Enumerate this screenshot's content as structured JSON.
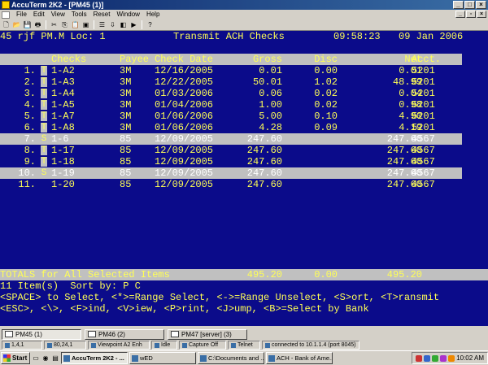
{
  "window": {
    "title": "AccuTerm 2K2 - [PM45 (1)]"
  },
  "menu": {
    "items": [
      "File",
      "Edit",
      "View",
      "Tools",
      "Reset",
      "Window",
      "Help"
    ]
  },
  "toolbar": {
    "icons": [
      "new-icon",
      "open-icon",
      "save-icon",
      "print-icon",
      "cut-icon",
      "copy-icon",
      "paste-icon",
      "select-icon",
      "properties-icon",
      "download-icon",
      "capture-icon",
      "run-icon",
      "help-icon"
    ]
  },
  "terminal": {
    "header_left": "45 rjf PM.M Loc: 1",
    "header_title": "Transmit ACH Checks",
    "header_time": "09:58:23",
    "header_date": "09 Jan 2006",
    "columns": {
      "checks": "Checks",
      "payee": "Payee",
      "date": "Check Date",
      "gross": "Gross",
      "disc": "Disc",
      "net": "Net",
      "acct": "Acct."
    },
    "rows": [
      {
        "idx": "1.",
        "flag": "T",
        "check": "1-A2",
        "payee": "3M",
        "date": "12/16/2005",
        "gross": "0.01",
        "disc": "0.00",
        "net": "0.01",
        "acct": "5201"
      },
      {
        "idx": "2.",
        "flag": "T",
        "check": "1-A3",
        "payee": "3M",
        "date": "12/22/2005",
        "gross": "50.01",
        "disc": "1.02",
        "net": "48.99",
        "acct": "5201"
      },
      {
        "idx": "3.",
        "flag": "T",
        "check": "1-A4",
        "payee": "3M",
        "date": "01/03/2006",
        "gross": "0.06",
        "disc": "0.02",
        "net": "0.04",
        "acct": "5201"
      },
      {
        "idx": "4.",
        "flag": "T",
        "check": "1-A5",
        "payee": "3M",
        "date": "01/04/2006",
        "gross": "1.00",
        "disc": "0.02",
        "net": "0.98",
        "acct": "5201"
      },
      {
        "idx": "5.",
        "flag": "T",
        "check": "1-A7",
        "payee": "3M",
        "date": "01/06/2006",
        "gross": "5.00",
        "disc": "0.10",
        "net": "4.90",
        "acct": "5201"
      },
      {
        "idx": "6.",
        "flag": "T",
        "check": "1-A8",
        "payee": "3M",
        "date": "01/06/2006",
        "gross": "4.28",
        "disc": "0.09",
        "net": "4.19",
        "acct": "5201"
      },
      {
        "idx": "7.",
        "flag": "S",
        "check": "1-6",
        "payee": "85",
        "date": "12/09/2005",
        "gross": "247.60",
        "disc": "",
        "net": "247.60",
        "acct": "4567",
        "selected": true
      },
      {
        "idx": "8.",
        "flag": "T",
        "check": "1-17",
        "payee": "85",
        "date": "12/09/2005",
        "gross": "247.60",
        "disc": "",
        "net": "247.60",
        "acct": "4567"
      },
      {
        "idx": "9.",
        "flag": "T",
        "check": "1-18",
        "payee": "85",
        "date": "12/09/2005",
        "gross": "247.60",
        "disc": "",
        "net": "247.60",
        "acct": "4567"
      },
      {
        "idx": "10.",
        "flag": "S",
        "check": "1-19",
        "payee": "85",
        "date": "12/09/2005",
        "gross": "247.60",
        "disc": "",
        "net": "247.60",
        "acct": "4567",
        "selected": true
      },
      {
        "idx": "11.",
        "flag": "",
        "check": "1-20",
        "payee": "85",
        "date": "12/09/2005",
        "gross": "247.60",
        "disc": "",
        "net": "247.60",
        "acct": "4567"
      }
    ],
    "totals_label": "TOTALS for All Selected Items",
    "totals_gross": "495.20",
    "totals_disc": "0.00",
    "totals_net": "495.20",
    "items_line": "11 Item(s)  Sort by: P C",
    "help_line_1": "<SPACE> to Select, <*>=Range Select, <->=Range Unselect, <S>ort, <T>ransmit",
    "help_line_2": "<ESC>, <\\>, <F>ind, <V>iew, <P>rint, <J>ump, <B>=Select by Bank"
  },
  "sessions": [
    {
      "label": "PM45 (1)",
      "active": true
    },
    {
      "label": "PM46 (2)",
      "active": false
    },
    {
      "label": "PM47 [server] (3)",
      "active": false
    }
  ],
  "statusbar": {
    "cursor": "1,4,1",
    "position": "80,24,1",
    "emulation": "Viewpoint A2 Enh",
    "state": "Idle",
    "capture": "Capture Off",
    "protocol": "Telnet",
    "connection": "connected to 10.1.1.4 (port 8045)"
  },
  "taskbar": {
    "start": "Start",
    "tasks": [
      {
        "label": "AccuTerm 2K2 - ...",
        "active": true
      },
      {
        "label": "wED",
        "active": false
      },
      {
        "label": "C:\\Documents and ...",
        "active": false
      },
      {
        "label": "ACH - Bank of Ame...",
        "active": false
      }
    ],
    "clock": "10:02 AM"
  }
}
